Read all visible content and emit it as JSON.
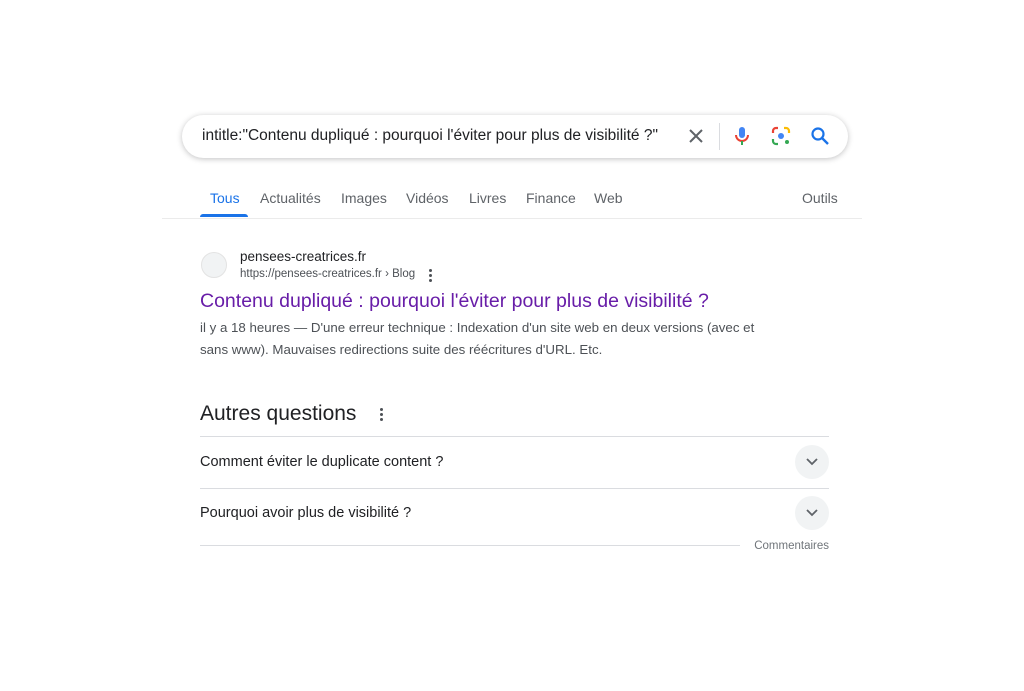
{
  "search": {
    "query": "intitle:\"Contenu dupliqué : pourquoi l'éviter pour plus de visibilité ?\""
  },
  "tabs": [
    {
      "label": "Tous",
      "active": true
    },
    {
      "label": "Actualités"
    },
    {
      "label": "Images"
    },
    {
      "label": "Vidéos"
    },
    {
      "label": "Livres"
    },
    {
      "label": "Finance"
    },
    {
      "label": "Web"
    }
  ],
  "tools_label": "Outils",
  "result": {
    "site": "pensees-creatrices.fr",
    "url": "https://pensees-creatrices.fr › Blog",
    "title": "Contenu dupliqué : pourquoi l'éviter pour plus de visibilité ?",
    "snippet_1": "il y a 18 heures — D'une erreur technique : Indexation d'un site web en deux versions (avec et",
    "snippet_2": "sans www). Mauvaises redirections suite des réécritures d'URL. Etc."
  },
  "paa": {
    "title": "Autres questions",
    "questions": [
      "Comment éviter le duplicate content ?",
      "Pourquoi avoir plus de visibilité ?"
    ],
    "feedback": "Commentaires"
  },
  "colors": {
    "link_visited": "#681da8",
    "accent": "#1a73e8"
  }
}
